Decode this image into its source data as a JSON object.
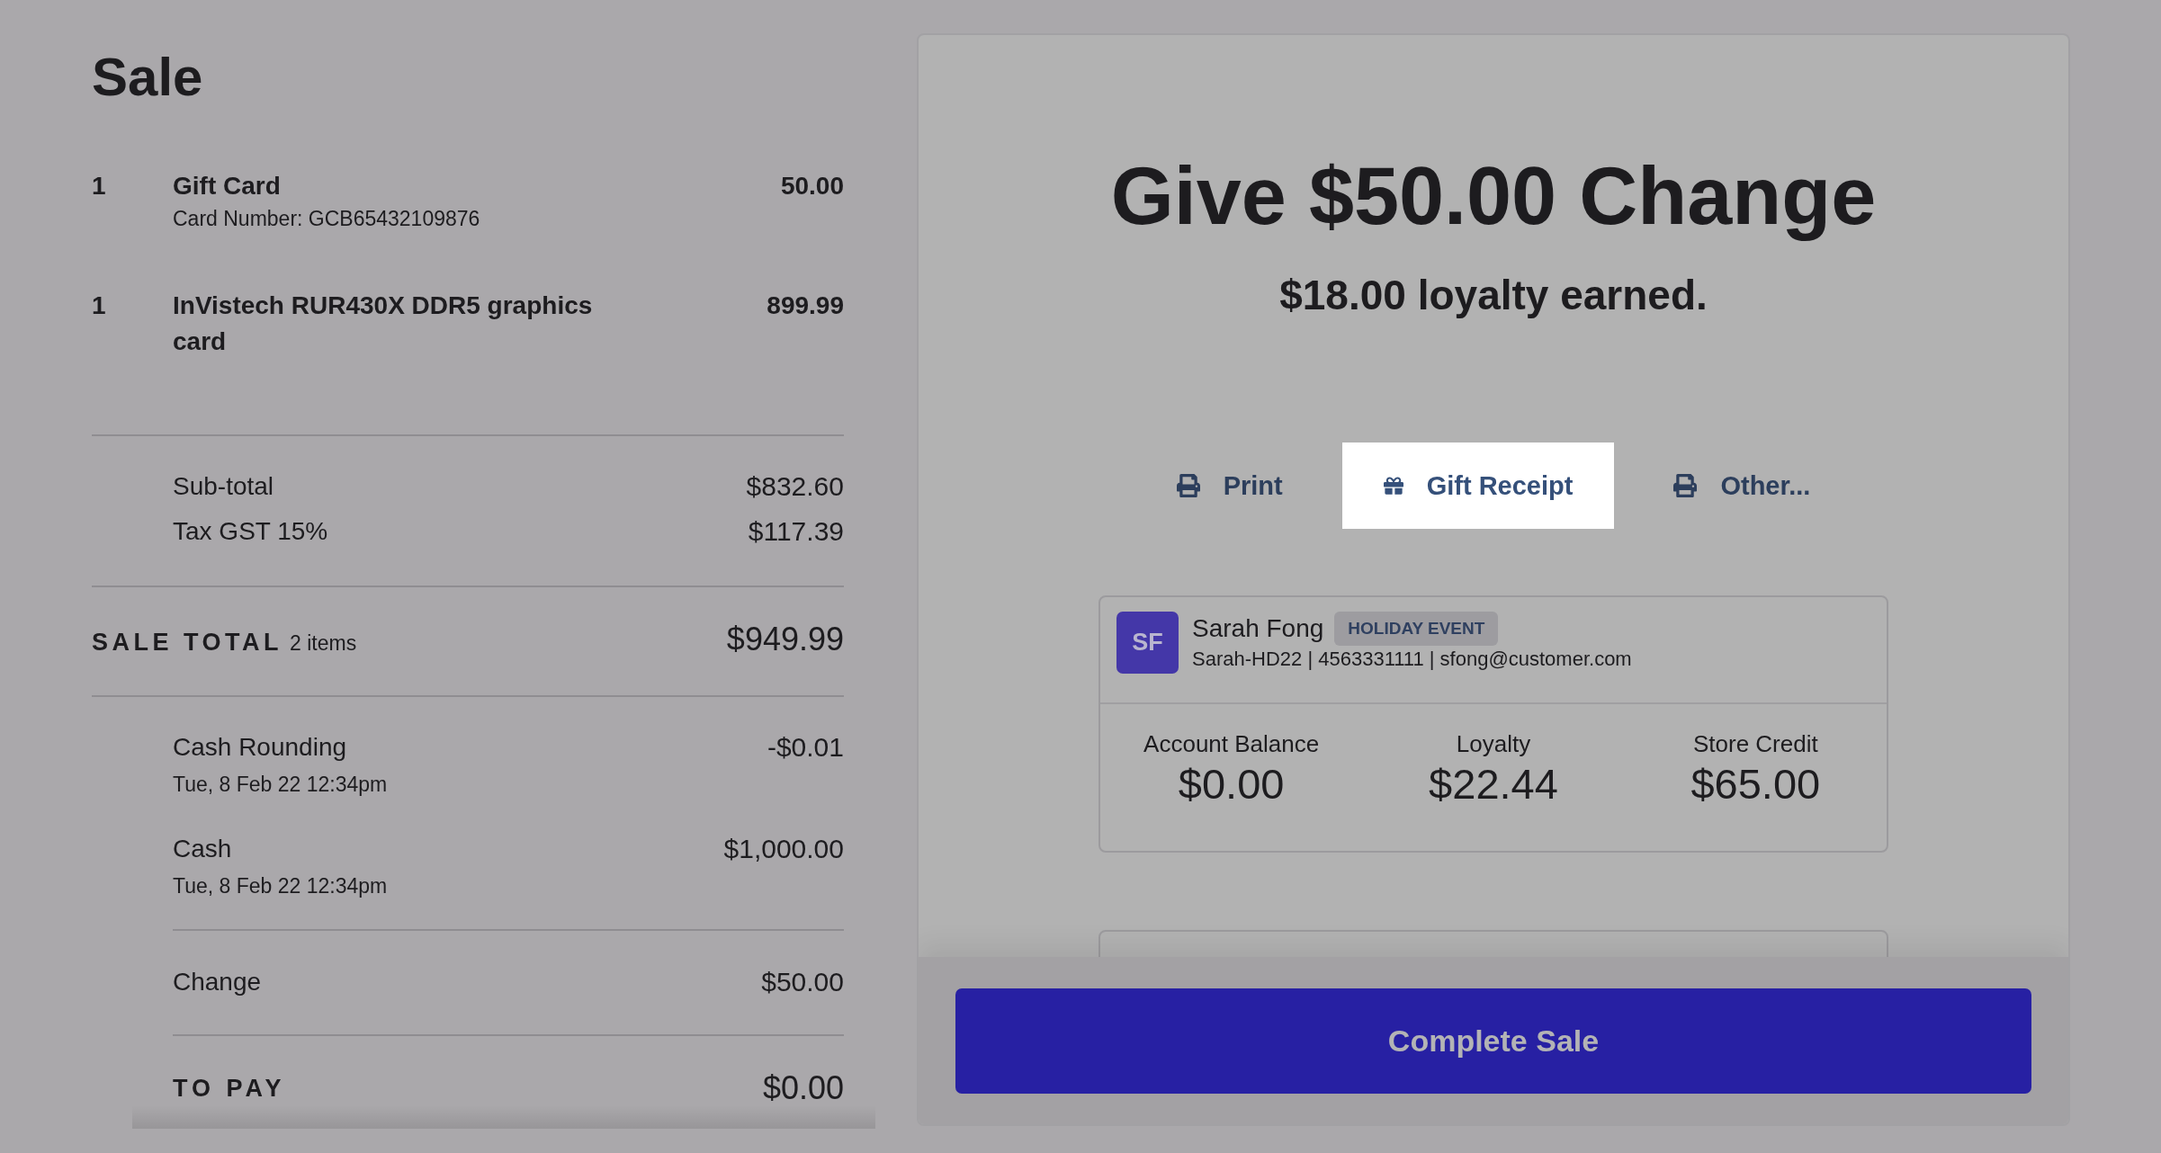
{
  "sale": {
    "title": "Sale",
    "line_items": [
      {
        "quantity": "1",
        "name": "Gift Card",
        "detail": "Card Number: GCB65432109876",
        "price": "50.00"
      },
      {
        "quantity": "1",
        "name": "InVistech RUR430X DDR5 graphics card",
        "price": "899.99"
      }
    ],
    "summary": [
      {
        "label": "Sub-total",
        "value": "$832.60"
      },
      {
        "label": "Tax GST 15%",
        "value": "$117.39"
      }
    ],
    "sale_total": {
      "label": "SALE TOTAL",
      "count": "2 items",
      "value": "$949.99"
    },
    "payments": [
      {
        "label": "Cash Rounding",
        "date": "Tue, 8 Feb 22 12:34pm",
        "amount": "-$0.01"
      },
      {
        "label": "Cash",
        "date": "Tue, 8 Feb 22 12:34pm",
        "amount": "$1,000.00"
      }
    ],
    "change": {
      "label": "Change",
      "value": "$50.00"
    },
    "to_pay": {
      "label": "TO PAY",
      "value": "$0.00"
    }
  },
  "completion": {
    "heading": "Give $50.00 Change",
    "loyalty_note": "$18.00 loyalty earned.",
    "receipt_options": [
      {
        "kind": "printer",
        "label": "Print",
        "selected": false
      },
      {
        "kind": "gift",
        "label": "Gift Receipt",
        "selected": true
      },
      {
        "kind": "printer",
        "label": "Other...",
        "selected": false
      }
    ],
    "customer": {
      "initials": "SF",
      "name": "Sarah Fong",
      "tag": "HOLIDAY EVENT",
      "details": "Sarah-HD22 | 4563331111 | sfong@customer.com",
      "stats": [
        {
          "label": "Account Balance",
          "value": "$0.00"
        },
        {
          "label": "Loyalty",
          "value": "$22.44"
        },
        {
          "label": "Store Credit",
          "value": "$65.00"
        }
      ]
    },
    "complete_button": "Complete Sale"
  }
}
